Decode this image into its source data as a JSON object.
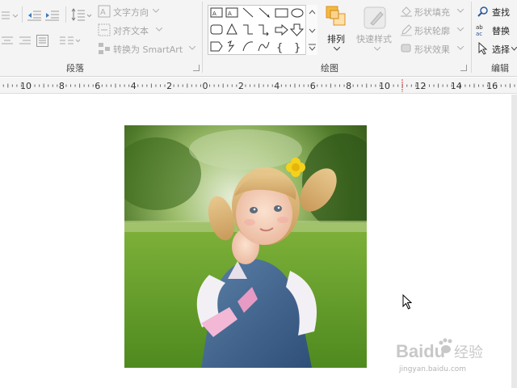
{
  "ribbon": {
    "paragraph": {
      "group_label": "段落",
      "text_direction": "文字方向",
      "align_text": "对齐文本",
      "convert_smartart": "转换为 SmartArt"
    },
    "drawing": {
      "group_label": "绘图",
      "arrange": "排列",
      "quick_styles": "快速样式",
      "shape_fill": "形状填充",
      "shape_outline": "形状轮廓",
      "shape_effects": "形状效果"
    },
    "editing": {
      "group_label": "编辑",
      "find": "查找",
      "replace": "替换",
      "select": "选择"
    }
  },
  "ruler": {
    "labels": [
      "10",
      "8",
      "6",
      "4",
      "2",
      "0",
      "2",
      "4",
      "6",
      "8",
      "10",
      "12",
      "14",
      "16"
    ]
  },
  "watermark": {
    "brand": "Baidu",
    "brand_cn": "经验",
    "url": "jingyan.baidu.com"
  },
  "colors": {
    "ribbon_bg": "#f4f4f4",
    "accent_orange": "#f0a030",
    "text_dim": "#a6a6a6",
    "text_dark": "#222222",
    "find_icon_blue": "#2b5797"
  }
}
